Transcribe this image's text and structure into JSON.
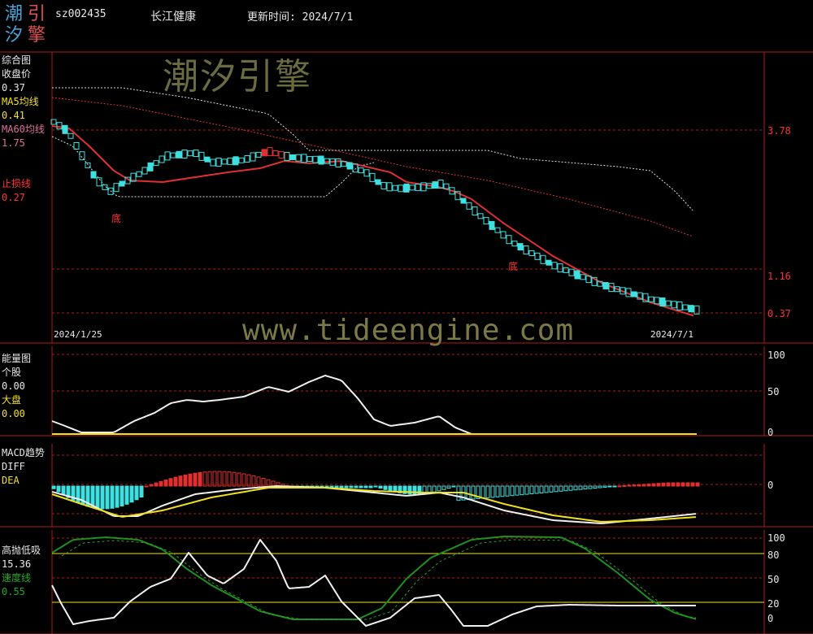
{
  "header": {
    "logo_chars": [
      "潮",
      "引",
      "汐",
      "擎"
    ],
    "code": "sz002435",
    "name": "长江健康",
    "update_label": "更新时间: 2024/7/1"
  },
  "watermark": {
    "cn": "潮汐引擎",
    "en": "www.tideengine.com"
  },
  "panel_main": {
    "title": "综合图",
    "close_label": "收盘价",
    "close_value": "0.37",
    "ma5_label": "MA5均线",
    "ma5_value": "0.41",
    "ma60_label": "MA60均线",
    "ma60_value": "1.75",
    "stop_label": "止损线",
    "stop_value": "0.27",
    "bottom_marker": "底",
    "date_start": "2024/1/25",
    "date_end": "2024/7/1",
    "axis_labels": [
      "3.78",
      "1.16",
      "0.37"
    ]
  },
  "panel_energy": {
    "title": "能量图",
    "stock_label": "个股",
    "stock_value": "0.00",
    "market_label": "大盘",
    "market_value": "0.00",
    "axis_labels": [
      "100",
      "50",
      "0"
    ]
  },
  "panel_macd": {
    "title": "MACD趋势",
    "diff_label": "DIFF",
    "dea_label": "DEA",
    "axis_label": "0"
  },
  "panel_kdj": {
    "title": "高抛低吸",
    "value": "15.36",
    "speed_label": "速度线",
    "speed_value": "0.55",
    "axis_labels": [
      "100",
      "80",
      "50",
      "20",
      "0"
    ]
  },
  "colors": {
    "grid_red": "#b01818",
    "ma60": "#e03030",
    "up_candle": "#40e0e0",
    "down_candle": "#e03030",
    "white_line": "#f0f0f0",
    "yellow_line": "#f2e020",
    "green_line": "#1f8f1f"
  },
  "chart_data": {
    "type": "line",
    "x_range": [
      "2024/1/25",
      "2024/7/1"
    ],
    "main_price_levels": [
      3.78,
      1.16,
      0.37
    ],
    "close_last": 0.37,
    "ma5_last": 0.41,
    "ma60_last": 1.75,
    "stop_last": 0.27,
    "energy_levels": [
      100,
      50,
      0
    ],
    "kdj_levels": [
      100,
      80,
      50,
      20,
      0
    ],
    "kdj_last": 15.36,
    "speed_last": 0.55
  }
}
